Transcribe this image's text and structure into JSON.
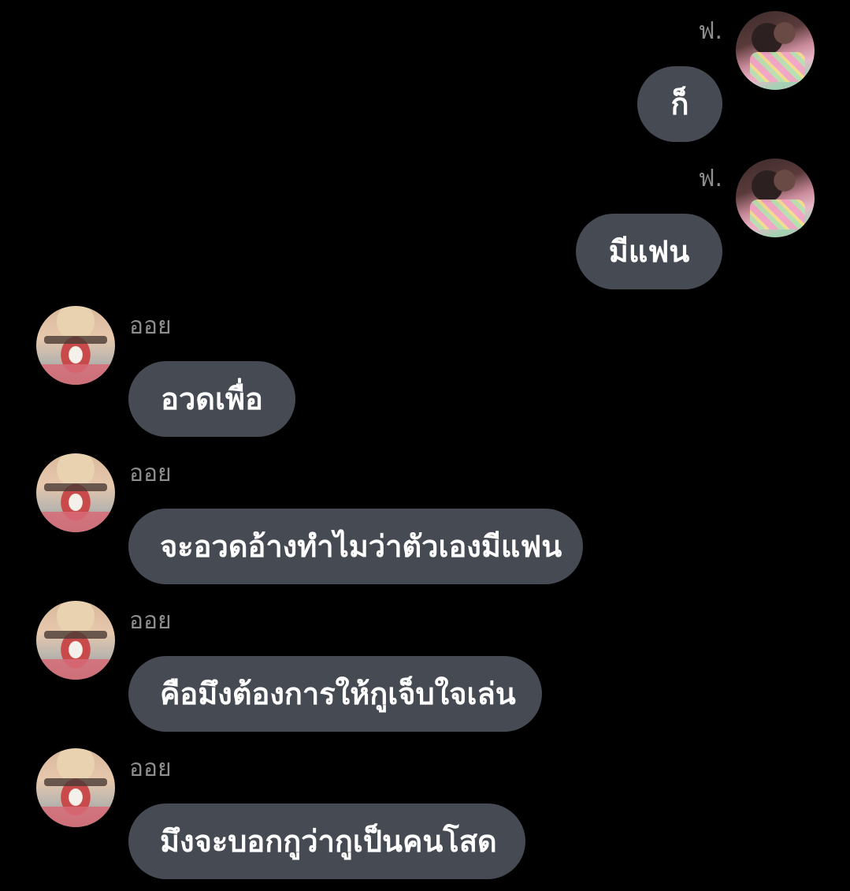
{
  "messages": [
    {
      "sender": "ฟ.",
      "side": "right",
      "text": "ก็"
    },
    {
      "sender": "ฟ.",
      "side": "right",
      "text": "มีแฟน"
    },
    {
      "sender": "ออย",
      "side": "left",
      "text": "อวดเพื่อ"
    },
    {
      "sender": "ออย",
      "side": "left",
      "text": "จะอวดอ้างทำไมว่าตัวเองมีแฟน"
    },
    {
      "sender": "ออย",
      "side": "left",
      "text": "คือมึงต้องการให้กูเจ็บใจเล่น"
    },
    {
      "sender": "ออย",
      "side": "left",
      "text": "มึงจะบอกกูว่ากูเป็นคนโสด"
    }
  ],
  "colors": {
    "background": "#000000",
    "bubble": "#464a53",
    "sender_name": "#8e8e8e",
    "message_text": "#ffffff"
  }
}
